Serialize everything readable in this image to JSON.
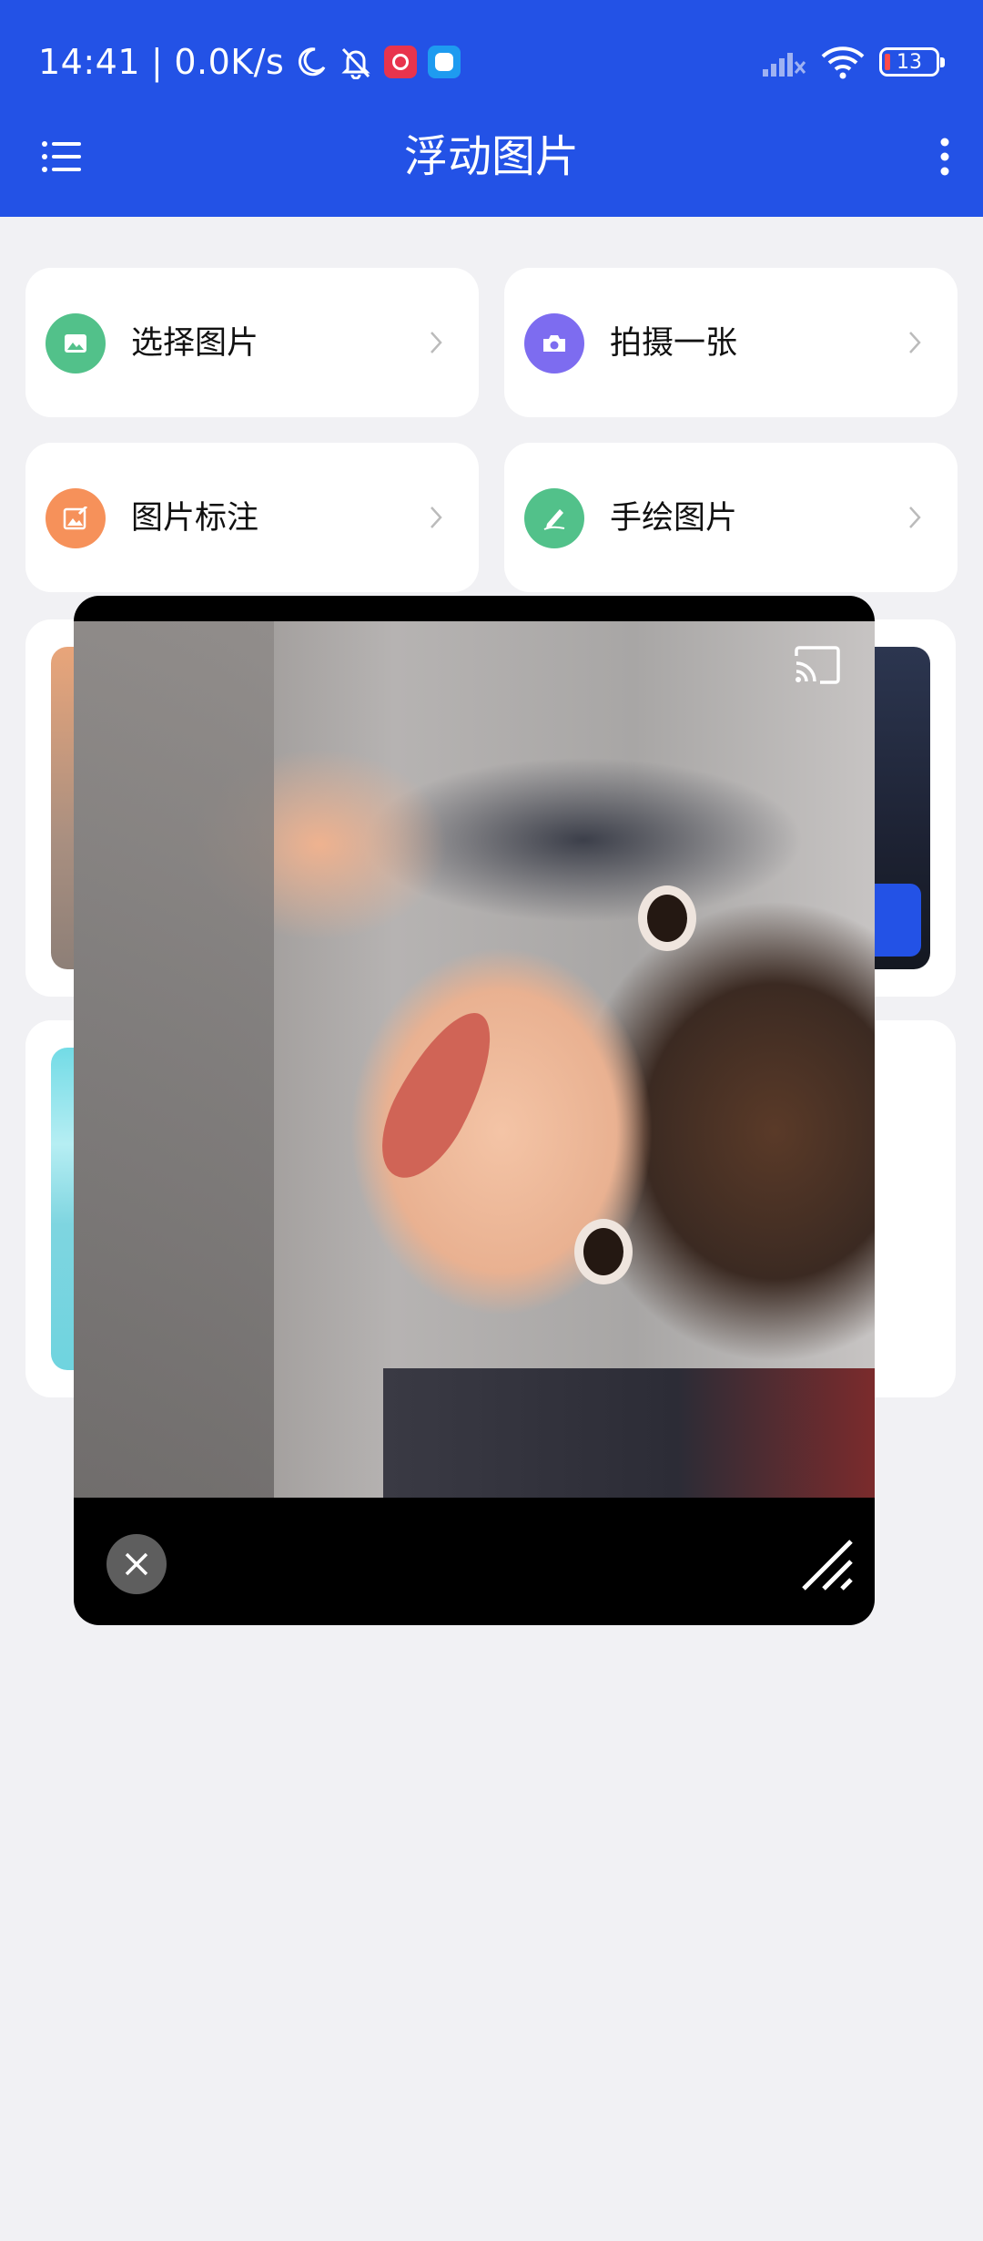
{
  "status_bar": {
    "time": "14:41",
    "separator": "|",
    "net_speed": "0.0K/s",
    "battery_level": "13",
    "icons": [
      "moon-icon",
      "bell-muted-icon",
      "app-notification-icon",
      "app-notification-icon",
      "signal-icon",
      "wifi-icon",
      "battery-icon"
    ]
  },
  "app_bar": {
    "title": "浮动图片",
    "left_icon": "menu-icon",
    "right_icon": "more-vertical-icon",
    "color": "#2352e6"
  },
  "actions": [
    {
      "label": "选择图片",
      "icon": "image-icon",
      "color": "#52c18a"
    },
    {
      "label": "拍摄一张",
      "icon": "camera-icon",
      "color": "#7d6cf0"
    },
    {
      "label": "图片标注",
      "icon": "annotate-image-icon",
      "color": "#f6915a"
    },
    {
      "label": "手绘图片",
      "icon": "pen-icon",
      "color": "#52c18a"
    }
  ],
  "floating_window": {
    "top_right_icon": "cast-icon",
    "close_icon": "close-icon",
    "resize_icon": "resize-handle-icon"
  }
}
